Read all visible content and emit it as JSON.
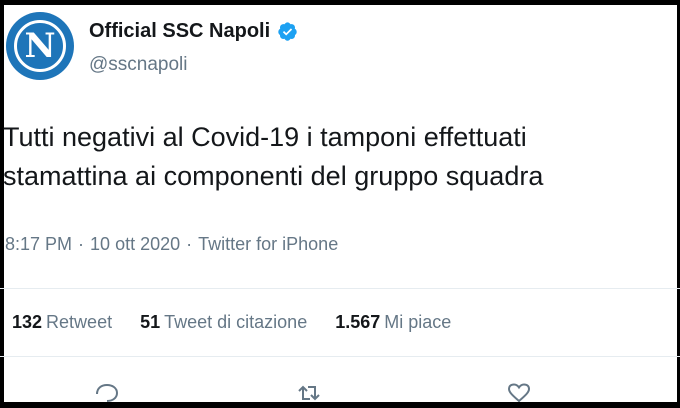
{
  "header": {
    "avatar_letter": "N",
    "display_name": "Official SSC Napoli",
    "handle": "@sscnapoli",
    "verified_icon": "verified-badge-icon",
    "brand_color": "#1e75b9",
    "verified_color": "#1da1f2"
  },
  "tweet": {
    "line1": "Tutti negativi al Covid-19 i tamponi effettuati",
    "line2": "stamattina ai componenti del gruppo squadra"
  },
  "meta": {
    "time": "8:17 PM",
    "separator": "·",
    "date": "10 ott 2020",
    "source": "Twitter for iPhone"
  },
  "stats": [
    {
      "count": "132",
      "label": "Retweet"
    },
    {
      "count": "51",
      "label": "Tweet di citazione"
    },
    {
      "count": "1.567",
      "label": "Mi piace"
    }
  ],
  "actions": [
    {
      "icon": "reply-icon"
    },
    {
      "icon": "retweet-icon"
    },
    {
      "icon": "like-icon"
    }
  ]
}
